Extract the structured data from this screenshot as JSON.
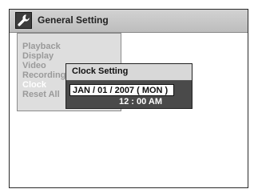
{
  "header": {
    "title": "General Setting",
    "icon": "wrench-icon"
  },
  "menu": {
    "items": [
      {
        "label": "Playback",
        "state": "inactive"
      },
      {
        "label": "Display",
        "state": "inactive"
      },
      {
        "label": "Video",
        "state": "inactive"
      },
      {
        "label": "Recording",
        "state": "inactive"
      },
      {
        "label": "Clock",
        "state": "selected"
      },
      {
        "label": "Reset All",
        "state": "inactive"
      }
    ]
  },
  "clock_dialog": {
    "title": "Clock Setting",
    "date": "JAN / 01 / 2007 ( MON )",
    "time": "12 : 00 AM"
  },
  "colors": {
    "header_bg": "#c8c8c8",
    "menu_panel_bg": "#dedede",
    "inactive_text": "#9a9a9a",
    "selected_text": "#ffffff",
    "dialog_bg": "#4a4a4a",
    "dialog_header_bg": "#d8d8d8"
  }
}
